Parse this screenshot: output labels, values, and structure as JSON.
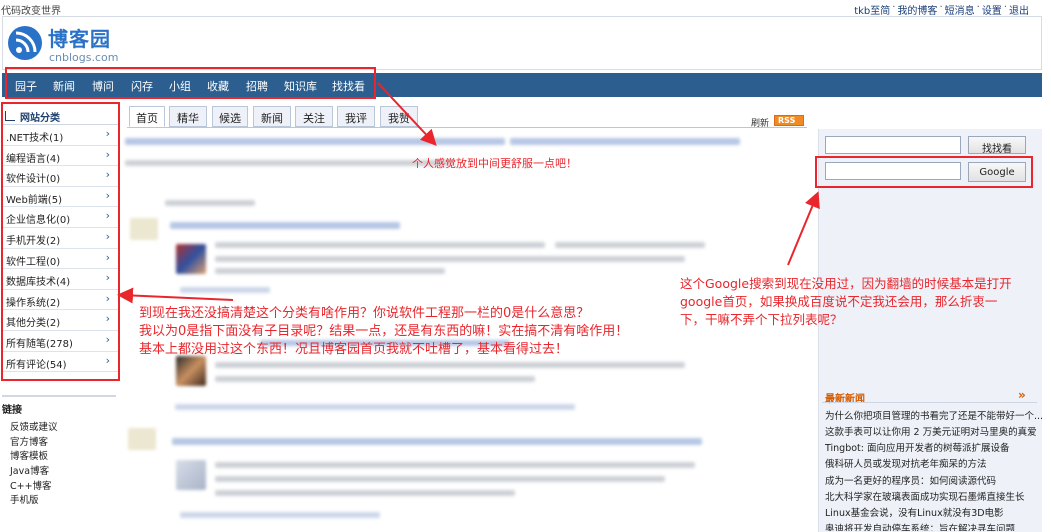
{
  "topbar": {
    "slogan": "代码改变世界",
    "links": [
      "tkb至简",
      "我的博客",
      "短消息",
      "设置",
      "退出"
    ],
    "separator": "·"
  },
  "header": {
    "logo_icon": "rss-circle-icon",
    "title": "博客园",
    "subtitle": "cnblogs.com"
  },
  "nav": {
    "items": [
      "园子",
      "新闻",
      "博问",
      "闪存",
      "小组",
      "收藏",
      "招聘",
      "知识库",
      "找找看"
    ]
  },
  "sidebar": {
    "title": "网站分类",
    "items": [
      {
        "label": ".NET技术(1)"
      },
      {
        "label": "编程语言(4)"
      },
      {
        "label": "软件设计(0)"
      },
      {
        "label": "Web前端(5)"
      },
      {
        "label": "企业信息化(0)"
      },
      {
        "label": "手机开发(2)"
      },
      {
        "label": "软件工程(0)"
      },
      {
        "label": "数据库技术(4)"
      },
      {
        "label": "操作系统(2)"
      },
      {
        "label": "其他分类(2)"
      },
      {
        "label": "所有随笔(278)"
      },
      {
        "label": "所有评论(54)"
      }
    ],
    "chevron": "›"
  },
  "links": {
    "title": "链接",
    "items": [
      "反馈或建议",
      "官方博客",
      "博客模板",
      "Java博客",
      "C++博客",
      "手机版"
    ]
  },
  "tabs": {
    "items": [
      "首页",
      "精华",
      "候选",
      "新闻",
      "关注",
      "我评",
      "我赞"
    ],
    "active": "首页",
    "refresh": "刷新",
    "rss": "RSS"
  },
  "search": {
    "site_button": "找找看",
    "google_button": "Google"
  },
  "news": {
    "title": "最新新闻",
    "more": "»",
    "items": [
      "为什么你把项目管理的书看完了还是不能带好一个...",
      "这款手表可以让你用 2 万美元证明对马里奥的真爱",
      "Tingbot: 面向应用开发者的树莓派扩展设备",
      "俄科研人员或发现对抗老年痴呆的方法",
      "成为一名更好的程序员：如何阅读源代码",
      "北大科学家在玻璃表面成功实现石墨烯直接生长",
      "Linux基金会说，没有Linux就没有3D电影",
      "奥迪将开发自动停车系统：旨在解决寻车问题"
    ]
  },
  "annotations": {
    "nav_note": "个人感觉放到中间更舒服一点吧！",
    "sidebar_note": [
      "到现在我还没搞清楚这个分类有啥作用？你说软件工程那一栏的0是什么意思？",
      "我以为0是指下面没有子目录呢？结果一点，还是有东西的嘛！实在搞不清有啥作用！",
      "基本上都没用过这个东西！况且博客园首页我就不吐槽了，基本看得过去！"
    ],
    "search_note": [
      "这个Google搜索到现在没用过，因为翻墙的时候基本是打开",
      "google首页，如果换成百度说不定我还会用，那么折衷一",
      "下，干嘛不弄个下拉列表呢？"
    ]
  },
  "colors": {
    "nav_bg": "#2c5f8f",
    "annotation_red": "#e8262c",
    "brand_blue": "#2a72c7",
    "news_orange": "#d45a00"
  }
}
